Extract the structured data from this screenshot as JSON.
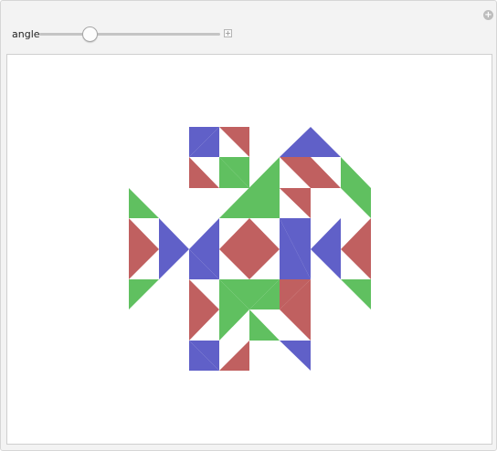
{
  "controls": {
    "angle_label": "angle",
    "slider_value": 0.28,
    "corner_button_glyph": "+",
    "plus_button_glyph": "+"
  },
  "colors": {
    "blue": "#6060c8",
    "red": "#c06060",
    "green": "#60c060",
    "gap": "#ffffff"
  },
  "icons": {
    "corner": "add-circle-icon",
    "plus": "plus-square-icon"
  }
}
